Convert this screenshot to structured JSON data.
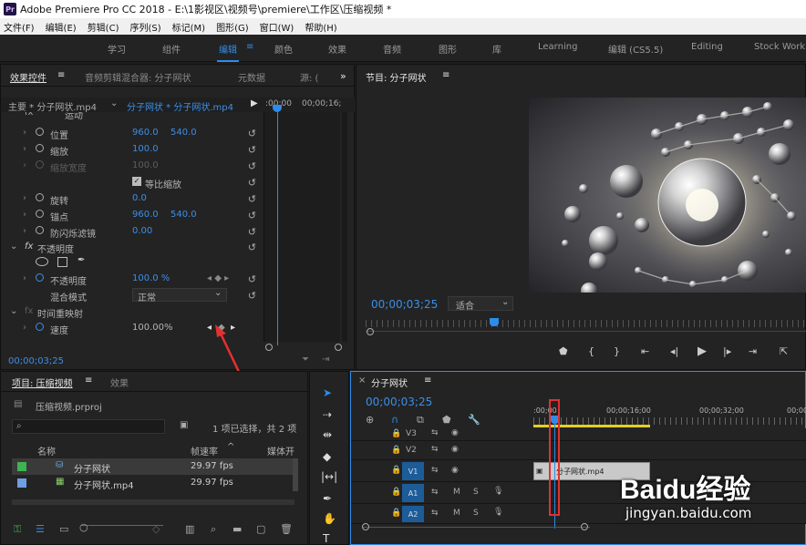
{
  "title": "Adobe Premiere Pro CC 2018 - E:\\1影视区\\视频号\\premiere\\工作区\\压缩视频 *",
  "app_icon": "Pr",
  "menu": [
    "文件(F)",
    "编辑(E)",
    "剪辑(C)",
    "序列(S)",
    "标记(M)",
    "图形(G)",
    "窗口(W)",
    "帮助(H)"
  ],
  "workspaces": [
    "学习",
    "组件",
    "编辑",
    "颜色",
    "效果",
    "音频",
    "图形",
    "库",
    "Learning",
    "编辑 (CS5.5)",
    "Editing",
    "Stock Work"
  ],
  "effect_panel": {
    "tabs": [
      "效果控件",
      "音频剪辑混合器: 分子网状",
      "元数据",
      "源: ("
    ],
    "master": "主要 * 分子网状.mp4",
    "clip": "分子网状 * 分子网状.mp4",
    "ruler": [
      ":00;00",
      "00;00;16;"
    ],
    "motion": "运动",
    "params": [
      {
        "name": "位置",
        "v1": "960.0",
        "v2": "540.0"
      },
      {
        "name": "缩放",
        "v1": "100.0",
        "v2": ""
      },
      {
        "name": "缩放宽度",
        "v1": "100.0",
        "v2": ""
      },
      {
        "name": "旋转",
        "v1": "0.0",
        "v2": ""
      },
      {
        "name": "锚点",
        "v1": "960.0",
        "v2": "540.0"
      },
      {
        "name": "防闪烁滤镜",
        "v1": "0.00",
        "v2": ""
      }
    ],
    "uniform": "等比缩放",
    "opacity_section": "不透明度",
    "opacity": {
      "name": "不透明度",
      "value": "100.0 %"
    },
    "blend": {
      "name": "混合模式",
      "value": "正常"
    },
    "remap": "时间重映射",
    "speed": {
      "name": "速度",
      "value": "100.00%"
    },
    "timecode": "00;00;03;25"
  },
  "program": {
    "tab": "节目: 分子网状",
    "timecode": "00;00;03;25",
    "fit": "适合"
  },
  "project": {
    "tabs": [
      "项目: 压缩视频",
      "效果"
    ],
    "file": "压缩视频.prproj",
    "selection": "1 项已选择，共 2 项",
    "columns": [
      "名称",
      "帧速率",
      "媒体开"
    ],
    "items": [
      {
        "name": "分子网状",
        "fps": "29.97 fps",
        "color": "#3fb34f"
      },
      {
        "name": "分子网状.mp4",
        "fps": "29.97 fps",
        "color": "#6f9ee0"
      }
    ]
  },
  "timeline": {
    "tab": "分子网状",
    "timecode": "00;00;03;25",
    "ruler": [
      ":00;00",
      "00;00;16;00",
      "00;00;32;00",
      "00;00"
    ],
    "tracks": [
      "V3",
      "V2",
      "V1",
      "A1",
      "A2"
    ],
    "clip": "分子网状.mp4",
    "track_buttons": [
      "M",
      "S"
    ]
  },
  "watermark": {
    "brand": "Baidu经验",
    "url": "jingyan.baidu.com"
  },
  "colors": {
    "accent": "#2d8ceb",
    "bg": "#232323",
    "panel_border": "#111111",
    "highlight": "#e03030"
  }
}
